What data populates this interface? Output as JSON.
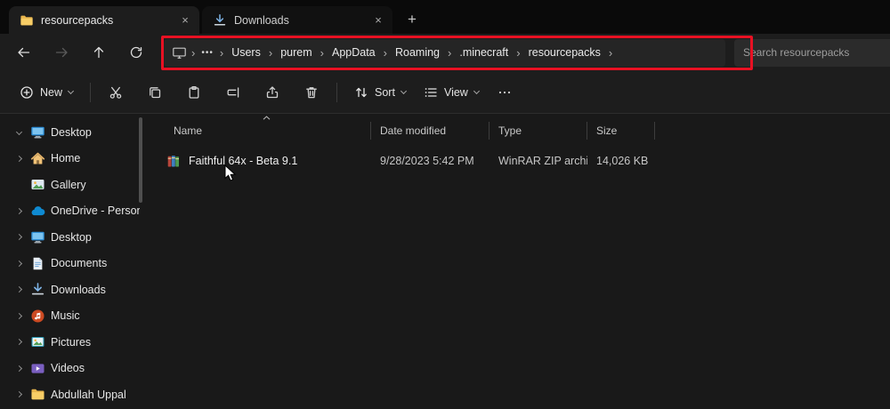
{
  "tabs": [
    {
      "label": "resourcepacks",
      "icon": "folder",
      "active": true
    },
    {
      "label": "Downloads",
      "icon": "download",
      "active": false
    }
  ],
  "tabbar": {
    "new_tab_label": "+"
  },
  "navigation": {
    "buttons": [
      {
        "icon": "back",
        "disabled": false
      },
      {
        "icon": "forward",
        "disabled": true
      },
      {
        "icon": "up",
        "disabled": false
      },
      {
        "icon": "refresh",
        "disabled": false
      }
    ],
    "overflow": "•••",
    "breadcrumbs": [
      "Users",
      "purem",
      "AppData",
      "Roaming",
      ".minecraft",
      "resourcepacks"
    ],
    "search_placeholder": "Search resourcepacks"
  },
  "toolbar": {
    "new_label": "New",
    "icons": [
      "cut",
      "copy",
      "paste",
      "rename",
      "share",
      "delete"
    ],
    "sort_label": "Sort",
    "view_label": "View"
  },
  "sidebar": {
    "items": [
      {
        "label": "Desktop",
        "icon": "monitor",
        "chevron": "down"
      },
      {
        "label": "Home",
        "icon": "home",
        "chevron": "right"
      },
      {
        "label": "Gallery",
        "icon": "gallery",
        "chevron": "none"
      },
      {
        "label": "OneDrive - Personal",
        "icon": "cloud",
        "chevron": "right"
      },
      {
        "label": "Desktop",
        "icon": "monitor",
        "chevron": "right"
      },
      {
        "label": "Documents",
        "icon": "document",
        "chevron": "right"
      },
      {
        "label": "Downloads",
        "icon": "download",
        "chevron": "right"
      },
      {
        "label": "Music",
        "icon": "music",
        "chevron": "right"
      },
      {
        "label": "Pictures",
        "icon": "pictures",
        "chevron": "right"
      },
      {
        "label": "Videos",
        "icon": "videos",
        "chevron": "right"
      },
      {
        "label": "Abdullah Uppal",
        "icon": "folder",
        "chevron": "right"
      }
    ]
  },
  "files": {
    "columns": [
      {
        "label": "Name",
        "sort": "asc"
      },
      {
        "label": "Date modified"
      },
      {
        "label": "Type"
      },
      {
        "label": "Size"
      }
    ],
    "rows": [
      {
        "icon": "zip",
        "name": "Faithful 64x - Beta 9.1",
        "date_modified": "9/28/2023 5:42 PM",
        "type": "WinRAR ZIP archive",
        "size": "14,026 KB"
      }
    ]
  },
  "annotation": {
    "color": "#e81123"
  }
}
